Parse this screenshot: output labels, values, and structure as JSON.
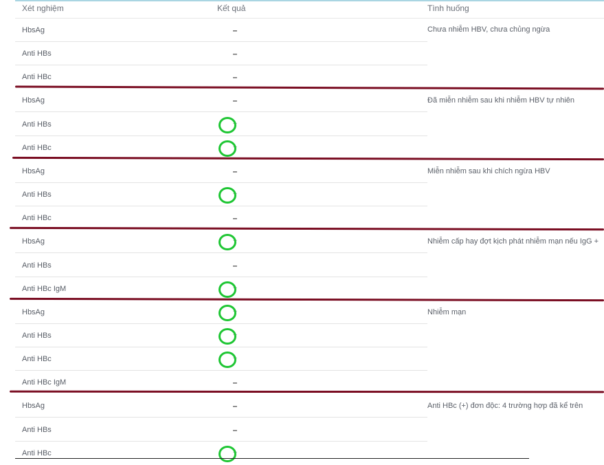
{
  "header": {
    "test": "Xét nghiệm",
    "result": "Kết quả",
    "situation": "Tình huống"
  },
  "groups": [
    {
      "situation": "Chưa nhiễm HBV, chưa chủng ngừa",
      "rows": [
        {
          "test": "HbsAg",
          "result": "–"
        },
        {
          "test": "Anti HBs",
          "result": "–"
        },
        {
          "test": "Anti HBc",
          "result": "–"
        }
      ]
    },
    {
      "situation": "Đã miễn nhiễm sau khi nhiễm HBV tự nhiên",
      "rows": [
        {
          "test": "HbsAg",
          "result": "–"
        },
        {
          "test": "Anti HBs",
          "result": "+"
        },
        {
          "test": "Anti HBc",
          "result": "+"
        }
      ]
    },
    {
      "situation": "Miễn nhiễm sau khi chích ngừa HBV",
      "rows": [
        {
          "test": "HbsAg",
          "result": "–"
        },
        {
          "test": "Anti HBs",
          "result": "+"
        },
        {
          "test": "Anti HBc",
          "result": "–"
        }
      ]
    },
    {
      "situation": "Nhiễm cấp hay đợt kịch phát nhiễm mạn nếu IgG +",
      "rows": [
        {
          "test": "HbsAg",
          "result": "+"
        },
        {
          "test": "Anti HBs",
          "result": "–"
        },
        {
          "test": "Anti HBc IgM",
          "result": "+"
        }
      ]
    },
    {
      "situation": "Nhiễm mạn",
      "rows": [
        {
          "test": "HbsAg",
          "result": "+"
        },
        {
          "test": "Anti HBs",
          "result": "+"
        },
        {
          "test": "Anti HBc",
          "result": "+"
        },
        {
          "test": "Anti HBc IgM",
          "result": "–"
        }
      ]
    },
    {
      "situation": "Anti HBc (+) đơn độc: 4 trường hợp đã kể trên",
      "rows": [
        {
          "test": "HbsAg",
          "result": "–"
        },
        {
          "test": "Anti HBs",
          "result": "–"
        },
        {
          "test": "Anti HBc",
          "result": "+"
        }
      ]
    }
  ],
  "colors": {
    "circle": "#1ec633",
    "divider": "#7a0d22"
  }
}
